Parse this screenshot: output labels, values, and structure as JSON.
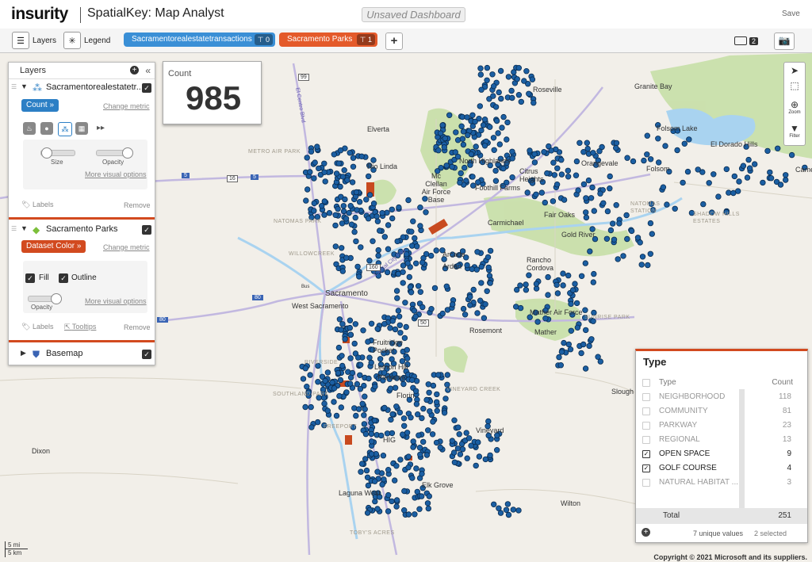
{
  "app": {
    "logo": "insurity",
    "title": "SpatialKey: Map Analyst",
    "dashboard_name": "Unsaved Dashboard",
    "save_label": "Save"
  },
  "toolbar": {
    "layers_label": "Layers",
    "legend_label": "Legend",
    "datasets": [
      {
        "label": "Sacramentorealestatetransactions",
        "count": "0",
        "color": "#3a8fd6"
      },
      {
        "label": "Sacramento Parks",
        "count": "1",
        "color": "#e45a2a"
      }
    ],
    "add_label": "+",
    "screens_count": "2"
  },
  "layers_panel": {
    "title": "Layers",
    "layers": [
      {
        "name": "Sacramentorealestatetr...",
        "metric": "Count",
        "change_metric": "Change metric",
        "size_label": "Size",
        "opacity_label": "Opacity",
        "more_options": "More visual options",
        "labels": "Labels",
        "remove": "Remove"
      },
      {
        "name": "Sacramento Parks",
        "metric": "Dataset Color",
        "change_metric": "Change metric",
        "fill_label": "Fill",
        "outline_label": "Outline",
        "opacity_label": "Opacity",
        "more_options": "More visual options",
        "labels": "Labels",
        "tooltips": "Tooltips",
        "remove": "Remove"
      },
      {
        "name": "Basemap"
      }
    ]
  },
  "count_widget": {
    "label": "Count",
    "value": "985"
  },
  "map_controls": {
    "zoom_label": "Zoom",
    "filter_label": "Filter"
  },
  "type_panel": {
    "title": "Type",
    "col_type": "Type",
    "col_count": "Count",
    "rows": [
      {
        "name": "NEIGHBORHOOD",
        "count": "118",
        "checked": false
      },
      {
        "name": "COMMUNITY",
        "count": "81",
        "checked": false
      },
      {
        "name": "PARKWAY",
        "count": "23",
        "checked": false
      },
      {
        "name": "REGIONAL",
        "count": "13",
        "checked": false
      },
      {
        "name": "OPEN SPACE",
        "count": "9",
        "checked": true
      },
      {
        "name": "GOLF COURSE",
        "count": "4",
        "checked": true
      },
      {
        "name": "NATURAL HABITAT ...",
        "count": "3",
        "checked": false
      }
    ],
    "total_label": "Total",
    "total_value": "251",
    "unique_values": "7 unique values",
    "selected": "2 selected"
  },
  "map_labels": {
    "roseville": "Roseville",
    "granite_bay": "Granite Bay",
    "folsom_lake": "Folsom Lake",
    "el_dorado_hills": "El Dorado Hills",
    "cameron": "Came",
    "elverta": "Elverta",
    "rio_linda": "Rio Linda",
    "north_highlands": "North Highlands",
    "mcclellan": "Mc Clellan Air Force Base",
    "citrus_heights": "Citrus Heights",
    "orangevale": "Orangevale",
    "folsom": "Folsom",
    "foothill_farms": "Foothill Farms",
    "natomas_station": "NATOMAS STATION",
    "fair_oaks": "Fair Oaks",
    "shadow_hills": "SHADOW HILLS ESTATES",
    "carmichael": "Carmichael",
    "gold_river": "Gold River",
    "metro_air_park": "METRO AIR PARK",
    "natomas_park": "NATOMAS PARK",
    "willow_creek": "WILLOWCREEK",
    "arcade": "Arcade",
    "arden": "Arden",
    "rancho_cordova": "Rancho Cordova",
    "sacramento": "Sacramento",
    "west_sacramento": "West Sacramento",
    "rosemont": "Rosemont",
    "mather_air_force": "Mather Air Force",
    "mather": "Mather",
    "sunrise_park": "SUNRISE PARK",
    "fruitridge_pocket": "Fruitridge Pocket",
    "lemon_hill": "Lemon Hill",
    "parkway": "Parkway",
    "riverside": "RIVERSIDE",
    "southland_park": "SOUTHLAND PARK",
    "florin": "Florin",
    "vineyard_creek": "VINEYARD CREEK",
    "sloughhouse": "Slough",
    "freeport": "FREEPORT",
    "vineyard": "Vineyard",
    "hig": "HIG",
    "dixon": "Dixon",
    "laguna_west": "Laguna West",
    "elk_grove": "Elk Grove",
    "wilton": "Wilton",
    "tobys_acres": "TOBY'S ACRES",
    "el_centro_blvd": "El Centro Blvd",
    "capital_city_fwy": "Capital City Fwy"
  },
  "highways": {
    "h99": "99",
    "h16": "16",
    "h5": "5",
    "h80": "80",
    "h160": "160",
    "h50": "50",
    "bus": "Bus"
  },
  "scale": {
    "mi": "5 mi",
    "km": "5 km"
  },
  "copyright": "Copyright © 2021 Microsoft and its suppliers.",
  "colors": {
    "accent_orange": "#d24a1f",
    "point_blue": "#1b5fa3",
    "park": "#c2dda0"
  }
}
